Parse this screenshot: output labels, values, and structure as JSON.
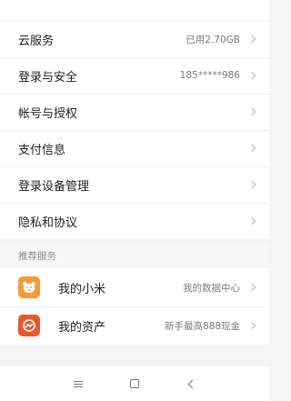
{
  "settings": [
    {
      "label": "云服务",
      "value": "已用2.70GB"
    },
    {
      "label": "登录与安全",
      "value": "185*****986"
    },
    {
      "label": "帐号与授权",
      "value": ""
    },
    {
      "label": "支付信息",
      "value": ""
    },
    {
      "label": "登录设备管理",
      "value": ""
    },
    {
      "label": "隐私和协议",
      "value": ""
    }
  ],
  "recommended": {
    "header": "推荐服务",
    "items": [
      {
        "label": "我的小米",
        "value": "我的数据中心",
        "icon": "mi-bear-icon",
        "icon_color": "#f39a3b"
      },
      {
        "label": "我的资产",
        "value": "新手最高888现金",
        "icon": "asset-icon",
        "icon_color": "#e55a2b"
      }
    ]
  },
  "navbar": {
    "icons": [
      "menu-icon",
      "home-icon",
      "back-icon"
    ]
  }
}
